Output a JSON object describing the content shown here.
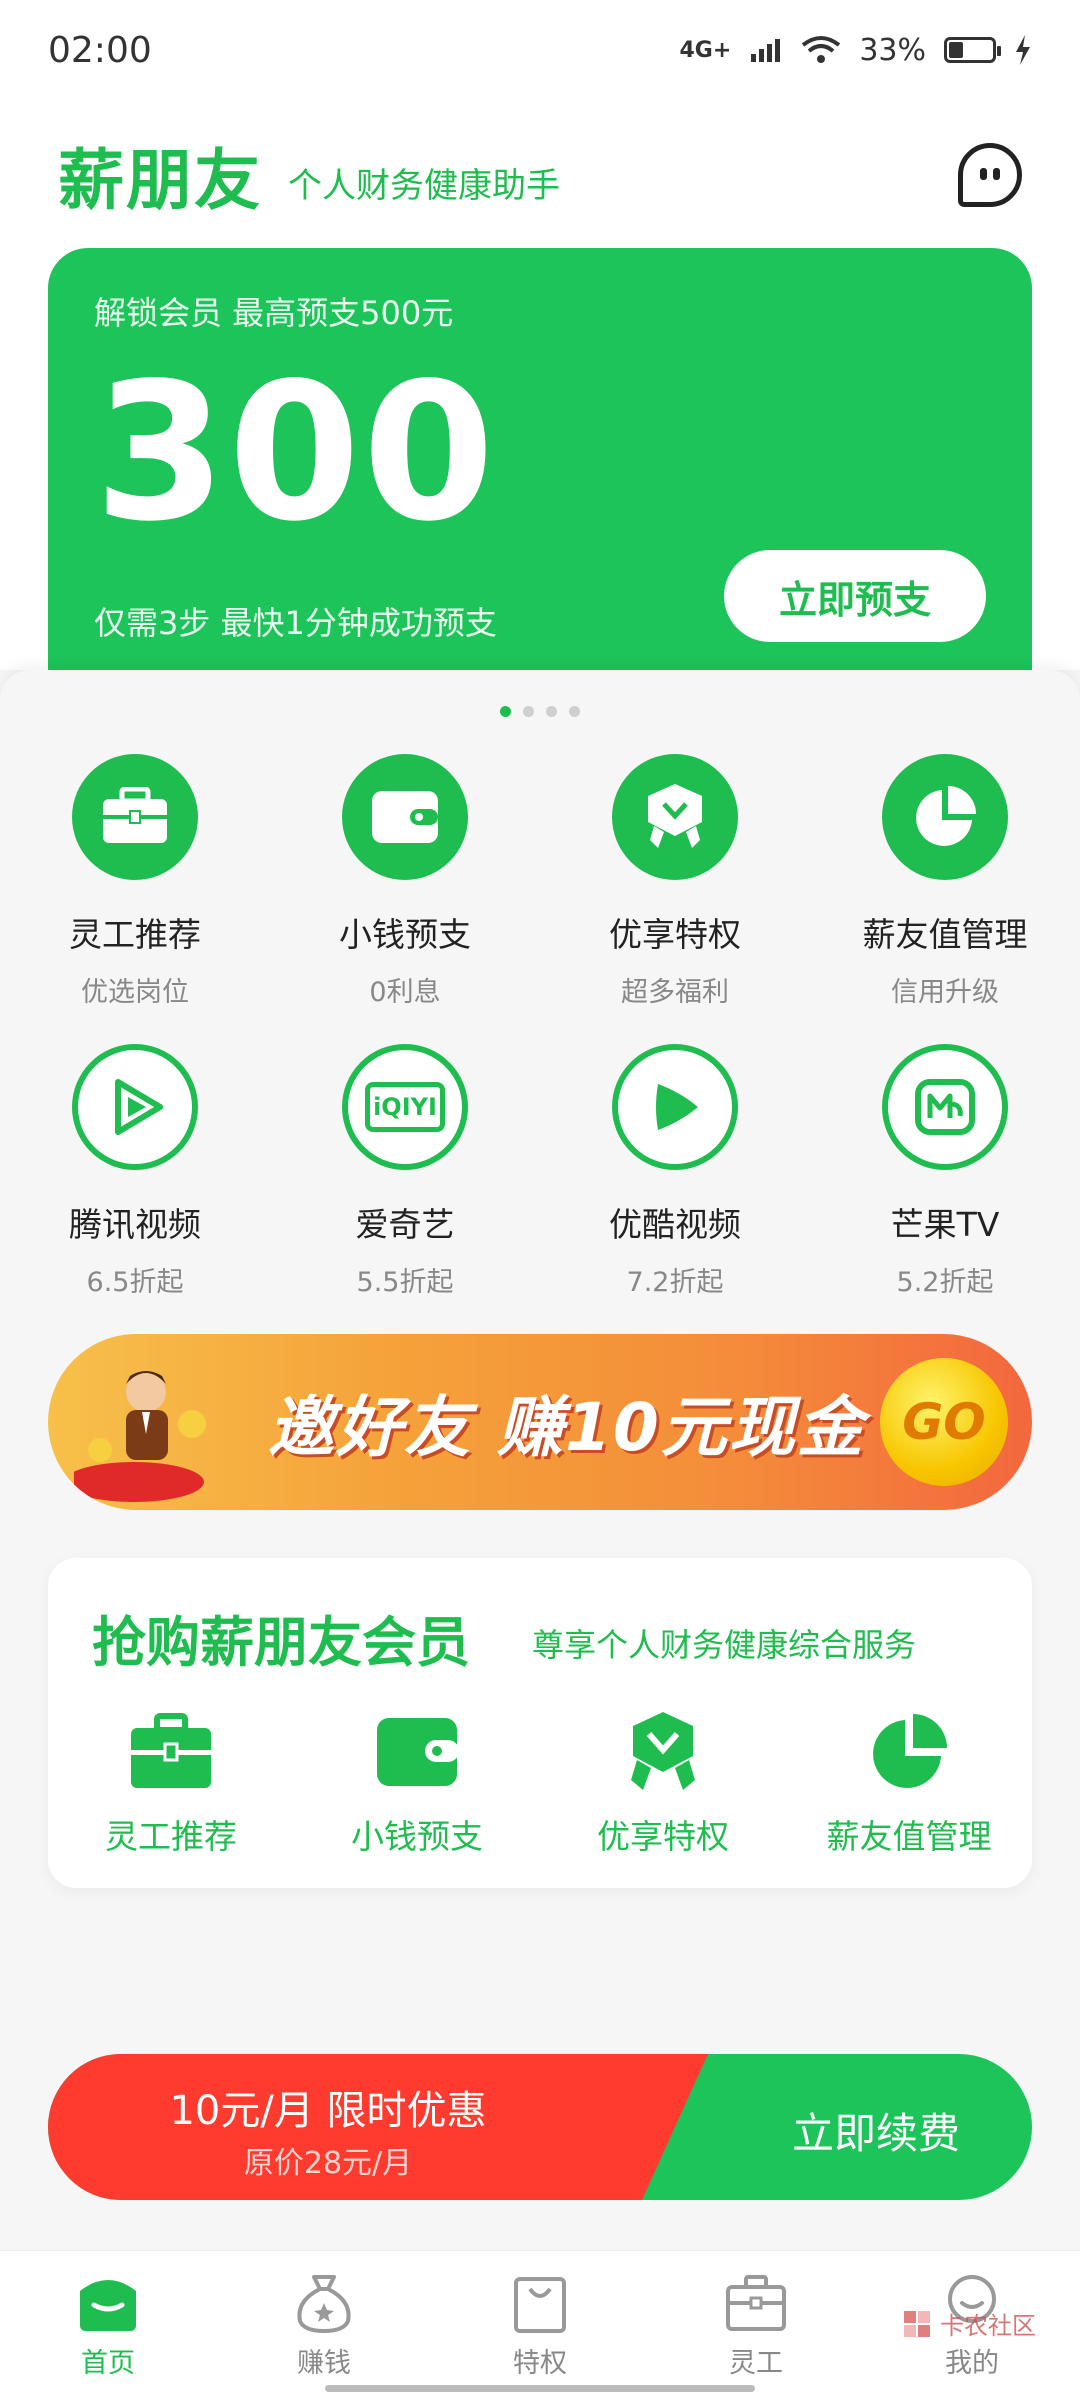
{
  "status_bar": {
    "time": "02:00",
    "network": "4G+",
    "battery": "33%"
  },
  "header": {
    "brand": "薪朋友",
    "tagline": "个人财务健康助手",
    "icon": "chat-bubble-icon"
  },
  "hero": {
    "subtitle": "解锁会员 最高预支500元",
    "amount": "300",
    "steps": "仅需3步 最快1分钟成功预支",
    "cta": "立即预支"
  },
  "carousel": {
    "pages": 4,
    "active": 1
  },
  "features": [
    {
      "title": "灵工推荐",
      "subtitle": "优选岗位",
      "icon": "briefcase-icon"
    },
    {
      "title": "小钱预支",
      "subtitle": "0利息",
      "icon": "wallet-icon"
    },
    {
      "title": "优享特权",
      "subtitle": "超多福利",
      "icon": "badge-icon"
    },
    {
      "title": "薪友值管理",
      "subtitle": "信用升级",
      "icon": "pie-chart-icon"
    }
  ],
  "video_features": [
    {
      "title": "腾讯视频",
      "subtitle": "6.5折起",
      "icon": "tencent-video-icon"
    },
    {
      "title": "爱奇艺",
      "subtitle": "5.5折起",
      "icon": "iqiyi-icon",
      "logo_text": "iQIYI"
    },
    {
      "title": "优酷视频",
      "subtitle": "7.2折起",
      "icon": "youku-icon"
    },
    {
      "title": "芒果TV",
      "subtitle": "5.2折起",
      "icon": "mango-tv-icon"
    }
  ],
  "banner": {
    "text": "邀好友 赚10元现金",
    "button": "GO"
  },
  "membership": {
    "title": "抢购薪朋友会员",
    "subtitle": "尊享个人财务健康综合服务",
    "items": [
      {
        "label": "灵工推荐",
        "icon": "briefcase-icon"
      },
      {
        "label": "小钱预支",
        "icon": "wallet-icon"
      },
      {
        "label": "优享特权",
        "icon": "badge-icon"
      },
      {
        "label": "薪友值管理",
        "icon": "pie-chart-icon"
      }
    ]
  },
  "renew": {
    "price": "10元/月 限时优惠",
    "original": "原价28元/月",
    "button": "立即续费"
  },
  "tabs": [
    {
      "label": "首页",
      "icon": "home-icon",
      "active": true
    },
    {
      "label": "赚钱",
      "icon": "money-bag-icon",
      "active": false
    },
    {
      "label": "特权",
      "icon": "shopping-bag-icon",
      "active": false
    },
    {
      "label": "灵工",
      "icon": "briefcase-icon",
      "active": false
    },
    {
      "label": "我的",
      "icon": "profile-icon",
      "active": false
    }
  ],
  "watermark": {
    "text": "卡农社区"
  },
  "colors": {
    "brand_green": "#1fbd4f",
    "hero_green": "#1dc45a",
    "promo_red": "#ff3b2f"
  }
}
